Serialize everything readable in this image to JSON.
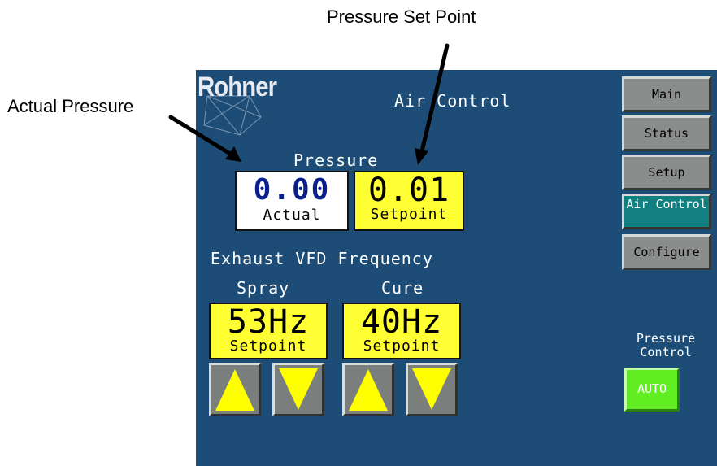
{
  "callouts": {
    "set_point": "Pressure Set Point",
    "actual": "Actual Pressure"
  },
  "panel": {
    "logo": "Rohner",
    "title": "Air Control",
    "pressure": {
      "heading": "Pressure",
      "actual": {
        "value": "0.00",
        "label": "Actual"
      },
      "setpoint": {
        "value": "0.01",
        "label": "Setpoint"
      }
    },
    "vfd": {
      "heading": "Exhaust VFD Frequency",
      "spray": {
        "label": "Spray",
        "value": "53Hz",
        "sublabel": "Setpoint",
        "up_icon": "triangle-up-icon",
        "down_icon": "triangle-down-icon"
      },
      "cure": {
        "label": "Cure",
        "value": "40Hz",
        "sublabel": "Setpoint",
        "up_icon": "triangle-up-icon",
        "down_icon": "triangle-down-icon"
      }
    },
    "nav": [
      {
        "label": "Main",
        "active": false
      },
      {
        "label": "Status",
        "active": false
      },
      {
        "label": "Setup",
        "active": false
      },
      {
        "label": "Air Control",
        "active": true
      },
      {
        "label": "Configure",
        "active": false
      }
    ],
    "pressure_control": {
      "label": "Pressure Control",
      "button": "AUTO"
    }
  },
  "colors": {
    "panel_bg": "#1d4d76",
    "value_yellow": "#ffff33",
    "nav_gray": "#8a8d8b",
    "nav_active": "#127f80",
    "auto_green": "#60ee23",
    "actual_digits": "#0a1e8c"
  }
}
